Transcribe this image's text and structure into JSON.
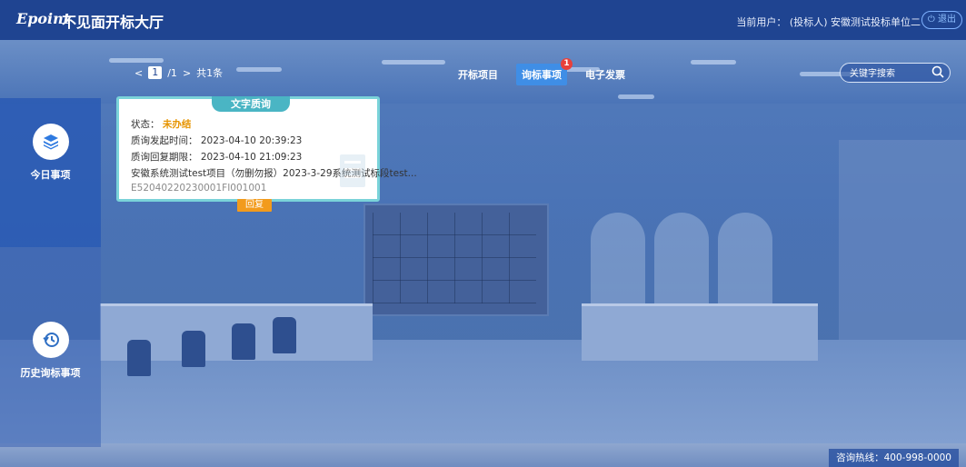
{
  "header": {
    "logo": "Epoint",
    "title": "不见面开标大厅",
    "user_label": "当前用户：",
    "user_role": "(投标人)",
    "user_name": "安徽测试投标单位二",
    "logout_label": "退出"
  },
  "sidebar": {
    "items": [
      {
        "label": "今日事项",
        "icon": "layers-icon",
        "active": true
      },
      {
        "label": "历史询标事项",
        "icon": "history-icon",
        "active": false
      }
    ]
  },
  "pager": {
    "current": "1",
    "total": "/1",
    "count": "共1条"
  },
  "tabs": [
    {
      "label": "开标项目",
      "active": false
    },
    {
      "label": "询标事项",
      "active": true,
      "badge": "1"
    },
    {
      "label": "电子发票",
      "active": false
    }
  ],
  "search": {
    "placeholder": "关键字搜索"
  },
  "card": {
    "title": "文字质询",
    "status_label": "状态：",
    "status_value": "未办结",
    "sent_time_label": "质询发起时间：",
    "sent_time": "2023-04-10 20:39:23",
    "deadline_label": "质询回复期限：",
    "deadline": "2023-04-10 21:09:23",
    "project": "安徽系统测试test项目（勿删勿报）2023-3-29系统测试标段test...",
    "code": "E52040220230001FI001001",
    "reply_label": "回复"
  },
  "footer": {
    "hotline": "咨询热线：400-998-0000"
  },
  "colors": {
    "topbar": "#1f4491",
    "card_border": "#7ad3d9",
    "status": "#e69400",
    "reply": "#f29b1d",
    "badge": "#e8403a"
  }
}
